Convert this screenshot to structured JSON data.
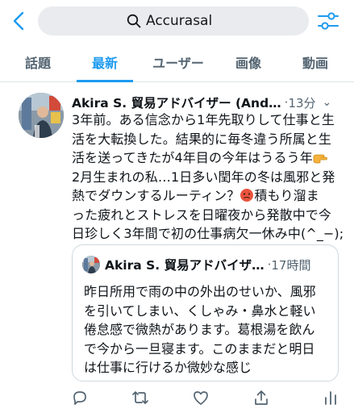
{
  "header": {
    "search_query": "Accurasal",
    "icons": {
      "back": "chevron-left-icon",
      "search": "search-icon",
      "filter": "sliders-icon"
    }
  },
  "tabs": [
    {
      "label": "話題",
      "active": false
    },
    {
      "label": "最新",
      "active": true
    },
    {
      "label": "ユーザー",
      "active": false
    },
    {
      "label": "画像",
      "active": false
    },
    {
      "label": "動画",
      "active": false
    }
  ],
  "tweet": {
    "author": "Akira S. 貿易アドバイザー (And…",
    "dot": "·",
    "time": "13分",
    "more": "⌄",
    "lines": [
      "3年前。ある信念から1年先取りして仕事と生",
      "活を大転換した。結果的に毎冬違う所属と生",
      "活を送ってきたが4年目の今年はうるう年",
      "2月生まれの私…1日多い閏年の冬は風邪と発",
      "熱でダウンするルーティン？",
      "積もり溜ま",
      "った疲れとストレスを日曜夜から発散中で今",
      "日珍しく3年間で初の仕事病欠一休み中(^_−);"
    ],
    "quote": {
      "author": "Akira S. 貿易アドバイザ…",
      "dot": "·",
      "time": "17時間",
      "lines": [
        "昨日所用で雨の中の外出のせいか、風邪",
        "を引いてしまい、くしゃみ・鼻水と軽い",
        "倦怠感で微熱があります。葛根湯を飲ん",
        "で今から一旦寝ます。このままだと明日",
        "は仕事に行けるか微妙な感じ"
      ]
    }
  },
  "actions": [
    "reply-icon",
    "retweet-icon",
    "like-icon",
    "share-icon",
    "analytics-icon"
  ],
  "colors": {
    "accent": "#1d9bf0",
    "muted": "#536471",
    "search_bg": "#e9ebee",
    "border": "#cfd9de"
  }
}
